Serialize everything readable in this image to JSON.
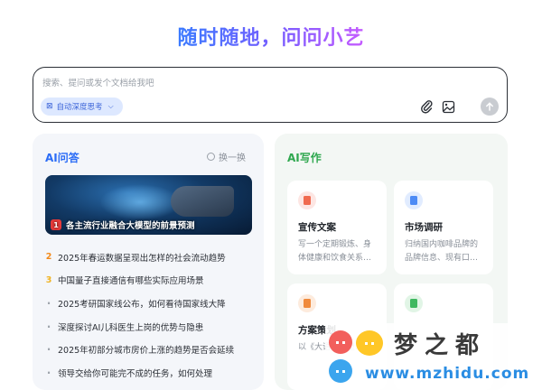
{
  "headline": "随时随地，问问小艺",
  "input": {
    "placeholder": "搜索、提问或发个文档给我吧",
    "deep_think_label": "自动深度思考",
    "icons": [
      "deep-think-icon",
      "attachment-icon",
      "image-icon",
      "send-icon"
    ]
  },
  "qa": {
    "title": "AI问答",
    "swap_label": "换一换",
    "featured": {
      "rank": "1",
      "text": "各主流行业融合大模型的前景预测"
    },
    "items": [
      {
        "rank": "2",
        "text": "2025年春运数据呈现出怎样的社会流动趋势"
      },
      {
        "rank": "3",
        "text": "中国量子直接通信有哪些实际应用场景"
      },
      {
        "rank": "·",
        "text": "2025考研国家线公布，如何看待国家线大降"
      },
      {
        "rank": "·",
        "text": "深度探讨AI儿科医生上岗的优势与隐患"
      },
      {
        "rank": "·",
        "text": "2025年初部分城市房价上涨的趋势是否会延续"
      },
      {
        "rank": "·",
        "text": "领导交给你可能完不成的任务，如何处理"
      }
    ]
  },
  "write": {
    "title": "AI写作",
    "cards": [
      {
        "name": "宣传文案",
        "desc": "写一个定期锻炼、身体健康和饮食关系…",
        "icon": "red"
      },
      {
        "name": "市场调研",
        "desc": "归纳国内咖啡品牌的品牌信息、现有口…",
        "icon": "blue"
      },
      {
        "name": "方案策划",
        "desc": "以《大语言模型…",
        "icon": "orange"
      },
      {
        "name": "",
        "desc": "",
        "icon": "green"
      }
    ]
  },
  "watermark": {
    "title": "梦之都",
    "url": "www.mzhidu.com"
  },
  "colors": {
    "accent_blue": "#2a6cf6",
    "accent_green": "#2fa84f",
    "rank1": "#e83a3a",
    "rank2": "#f28a1b",
    "rank3": "#f0b323"
  }
}
